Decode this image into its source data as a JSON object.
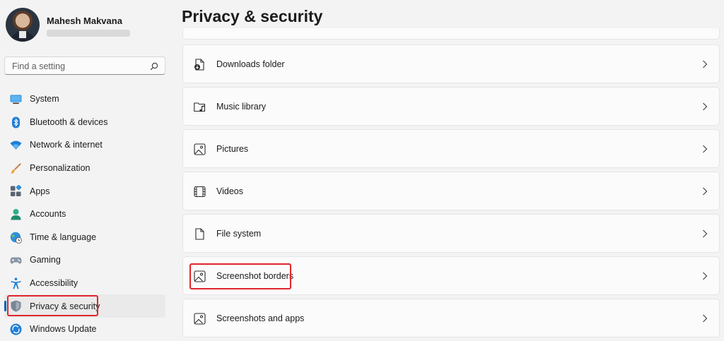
{
  "user": {
    "name": "Mahesh Makvana"
  },
  "search": {
    "placeholder": "Find a setting"
  },
  "sidebar": {
    "items": [
      {
        "label": "System",
        "icon": "system-icon"
      },
      {
        "label": "Bluetooth & devices",
        "icon": "bluetooth-icon"
      },
      {
        "label": "Network & internet",
        "icon": "wifi-icon"
      },
      {
        "label": "Personalization",
        "icon": "brush-icon"
      },
      {
        "label": "Apps",
        "icon": "apps-icon"
      },
      {
        "label": "Accounts",
        "icon": "person-icon"
      },
      {
        "label": "Time & language",
        "icon": "globe-clock-icon"
      },
      {
        "label": "Gaming",
        "icon": "gamepad-icon"
      },
      {
        "label": "Accessibility",
        "icon": "accessibility-icon"
      },
      {
        "label": "Privacy & security",
        "icon": "shield-icon",
        "active": true
      },
      {
        "label": "Windows Update",
        "icon": "update-icon"
      }
    ]
  },
  "main": {
    "title": "Privacy & security",
    "cards": [
      {
        "label": "Downloads folder",
        "icon": "downloads-folder-icon"
      },
      {
        "label": "Music library",
        "icon": "music-folder-icon"
      },
      {
        "label": "Pictures",
        "icon": "picture-icon"
      },
      {
        "label": "Videos",
        "icon": "video-icon"
      },
      {
        "label": "File system",
        "icon": "document-icon"
      },
      {
        "label": "Screenshot borders",
        "icon": "screenshot-icon",
        "highlighted": true
      },
      {
        "label": "Screenshots and apps",
        "icon": "screenshot-apps-icon"
      }
    ]
  },
  "colors": {
    "accent": "#005fb8",
    "highlight": "#e1252c",
    "background": "#f3f3f3",
    "card": "#fbfbfb"
  }
}
